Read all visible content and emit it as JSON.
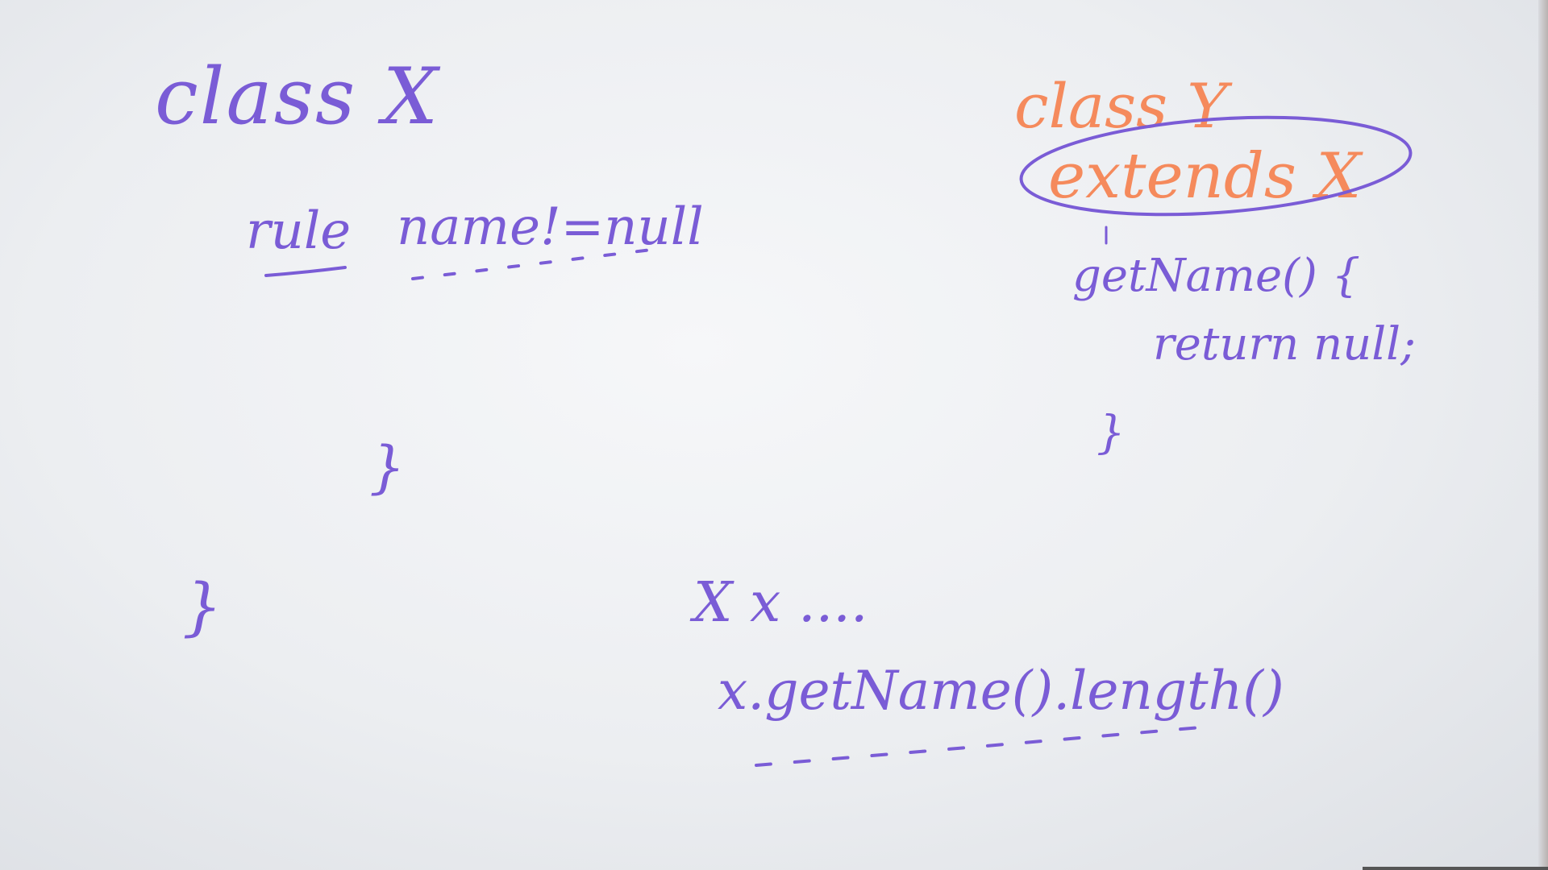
{
  "whiteboard": {
    "class_x_block": {
      "header": "class X",
      "rule_keyword": "rule",
      "rule_condition": "name!=null",
      "inner_brace": "}",
      "outer_brace": "}"
    },
    "class_y_block": {
      "header": "class Y",
      "extends_clause": "extends X",
      "method_signature": "getName() {",
      "method_body": "return null;",
      "closing_brace": "}"
    },
    "usage_block": {
      "declaration": "X x ....",
      "call_expression": "x.getName().length()"
    }
  },
  "colors": {
    "board": "#eceef1",
    "purple_marker": "#7a5cd6",
    "orange_marker": "#f58a5c"
  }
}
